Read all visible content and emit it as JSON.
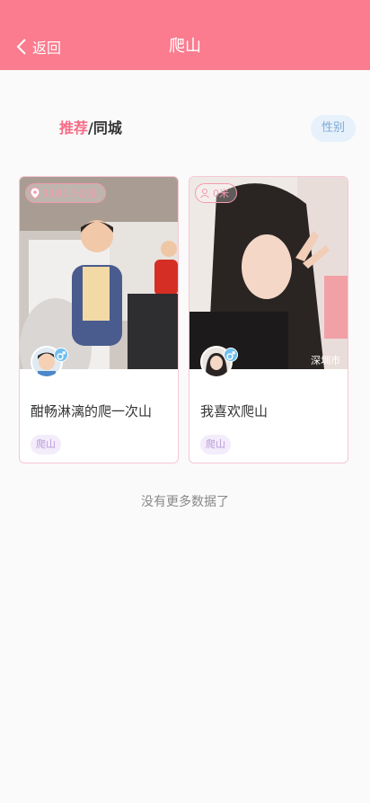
{
  "header": {
    "back_label": "返回",
    "title": "爬山",
    "color": "#fb7c8f"
  },
  "tabs": {
    "active": "推荐",
    "separator": "/",
    "other": "同城"
  },
  "filter": {
    "label": "性别"
  },
  "cards": [
    {
      "distance": "1181.5公里",
      "city": "",
      "title": "酣畅淋漓的爬一次山",
      "tag": "爬山",
      "gender": "male"
    },
    {
      "distance": "0米",
      "city": "深圳市",
      "title": "我喜欢爬山",
      "tag": "爬山",
      "gender": "male"
    }
  ],
  "footer": {
    "no_more": "没有更多数据了"
  }
}
